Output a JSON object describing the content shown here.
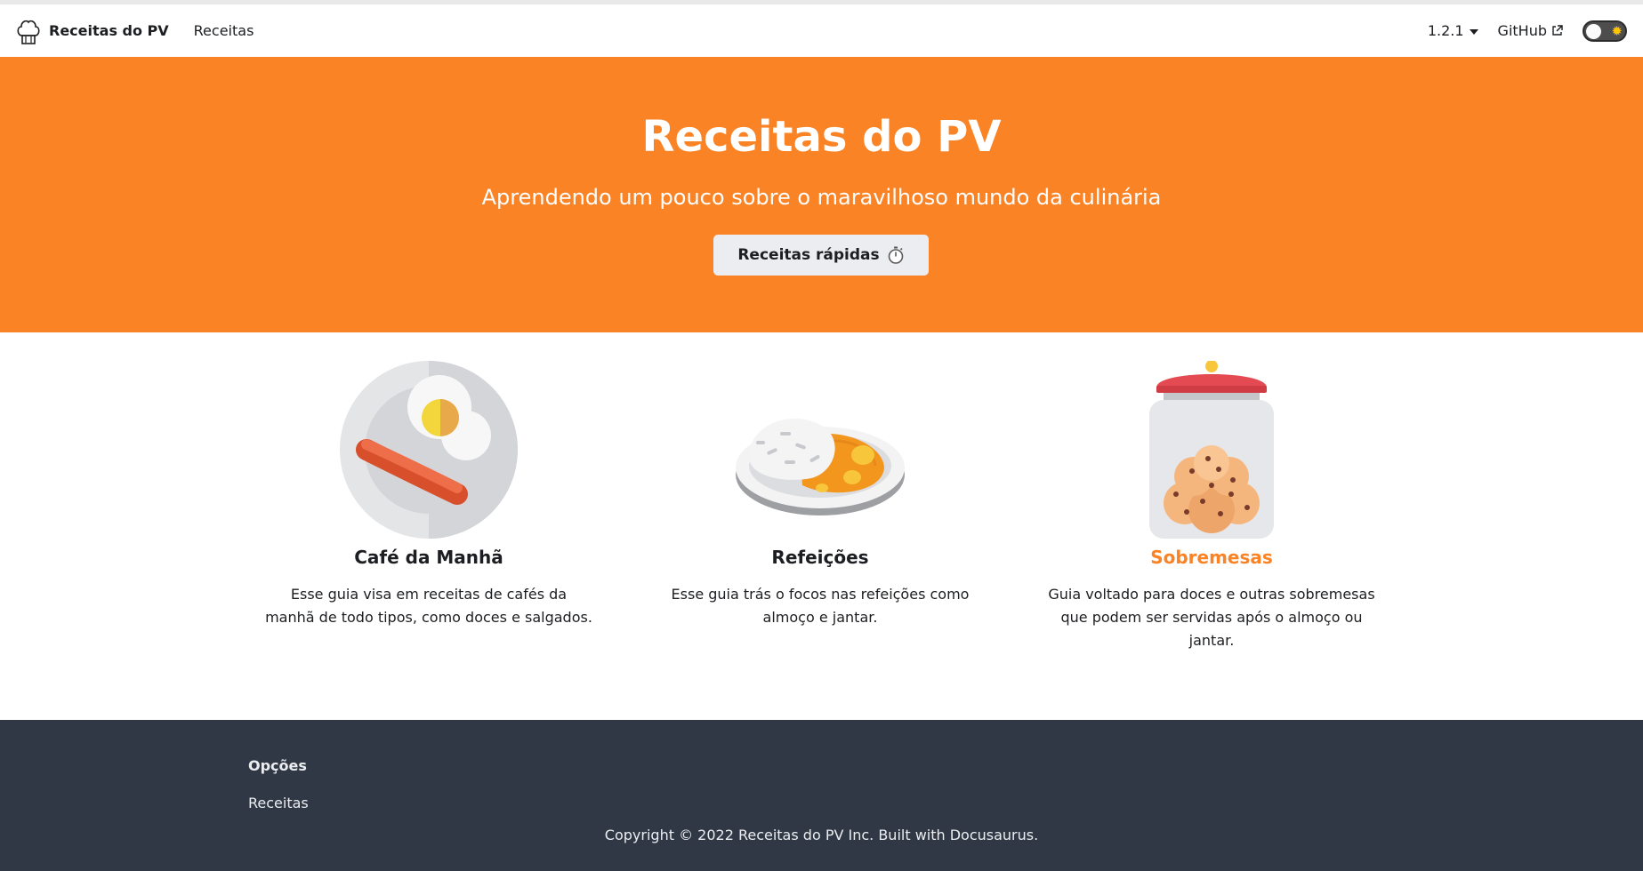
{
  "navbar": {
    "brand_title": "Receitas do PV",
    "logo_icon": "chef-hat-icon",
    "links": [
      {
        "label": "Receitas"
      }
    ],
    "version_label": "1.2.1",
    "github_label": "GitHub",
    "theme_toggle_icon": "sun-icon"
  },
  "hero": {
    "title": "Receitas do PV",
    "subtitle": "Aprendendo um pouco sobre o maravilhoso mundo da culinária",
    "button_label": "Receitas rápidas",
    "button_icon": "stopwatch-icon",
    "background_color": "#f98325"
  },
  "features": [
    {
      "icon": "breakfast-plate-icon",
      "title": "Café da Manhã",
      "description": "Esse guia visa em receitas de cafés da manhã de todo tipos, como doces e salgados."
    },
    {
      "icon": "rice-curry-plate-icon",
      "title": "Refeições",
      "description": "Esse guia trás o focos nas refeições como almoço e jantar."
    },
    {
      "icon": "cookie-jar-icon",
      "title": "Sobremesas",
      "description": "Guia voltado para doces e outras sobremesas que podem ser servidas após o almoço ou jantar.",
      "title_color": "#f98325"
    }
  ],
  "footer": {
    "heading": "Opções",
    "links": [
      {
        "label": "Receitas"
      }
    ],
    "copyright": "Copyright © 2022 Receitas do PV Inc. Built with Docusaurus.",
    "background_color": "#303846"
  }
}
